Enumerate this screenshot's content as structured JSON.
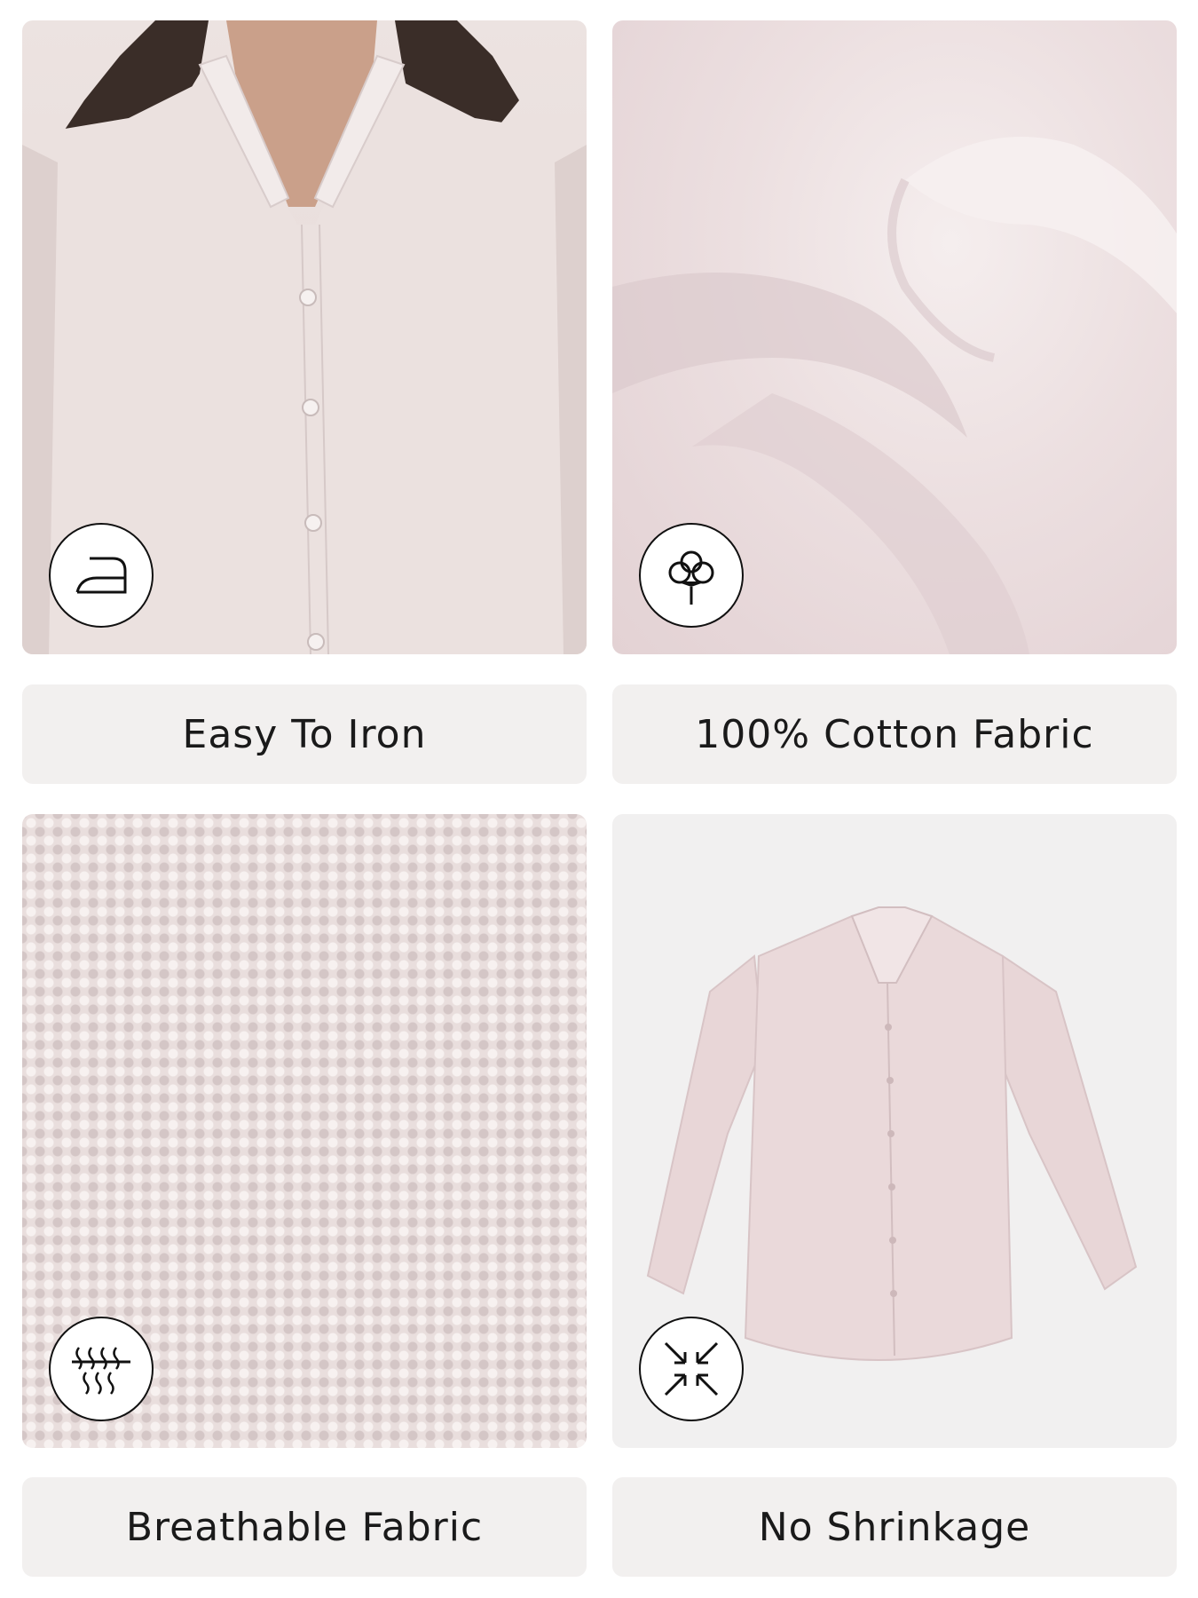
{
  "features": [
    {
      "label": "Easy To Iron",
      "icon": "iron-icon"
    },
    {
      "label": "100% Cotton Fabric",
      "icon": "cotton-flower-icon"
    },
    {
      "label": "Breathable Fabric",
      "icon": "breathable-icon"
    },
    {
      "label": "No Shrinkage",
      "icon": "no-shrinkage-icon"
    }
  ],
  "colors": {
    "label_background": "#f2f0ef",
    "fabric": "#e9dcdc",
    "text": "#1a1a1a"
  }
}
